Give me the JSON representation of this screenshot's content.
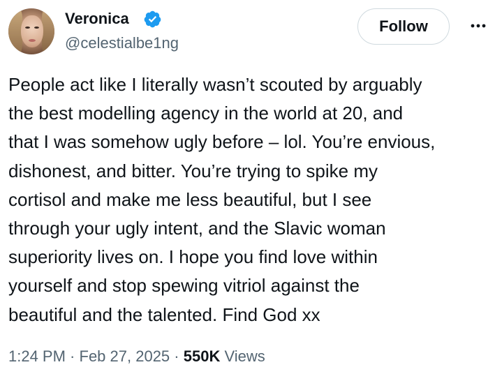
{
  "author": {
    "display_name": "Veronica",
    "handle": "@celestialbe1ng",
    "verified": true
  },
  "actions": {
    "follow_label": "Follow",
    "more_icon": "more-icon"
  },
  "post": {
    "lines": [
      "People act like I literally wasn’t scouted by arguably",
      "the best modelling agency in the world at 20, and",
      "that I was somehow ugly before – lol. You’re envious,",
      "dishonest, and bitter. You’re trying to spike my",
      "cortisol and make me less beautiful, but I see",
      "through your ugly intent, and the Slavic woman",
      "superiority lives on. I hope you find love within",
      "yourself and stop spewing vitriol against the",
      "beautiful and the talented. Find God xx"
    ]
  },
  "meta": {
    "time": "1:24 PM",
    "separator": " · ",
    "date": "Feb 27, 2025",
    "views_count": "550K",
    "views_label": " Views"
  },
  "colors": {
    "text_primary": "#0f1419",
    "text_secondary": "#536471",
    "verified_blue": "#1d9bf0",
    "button_border": "#cfd9de"
  }
}
